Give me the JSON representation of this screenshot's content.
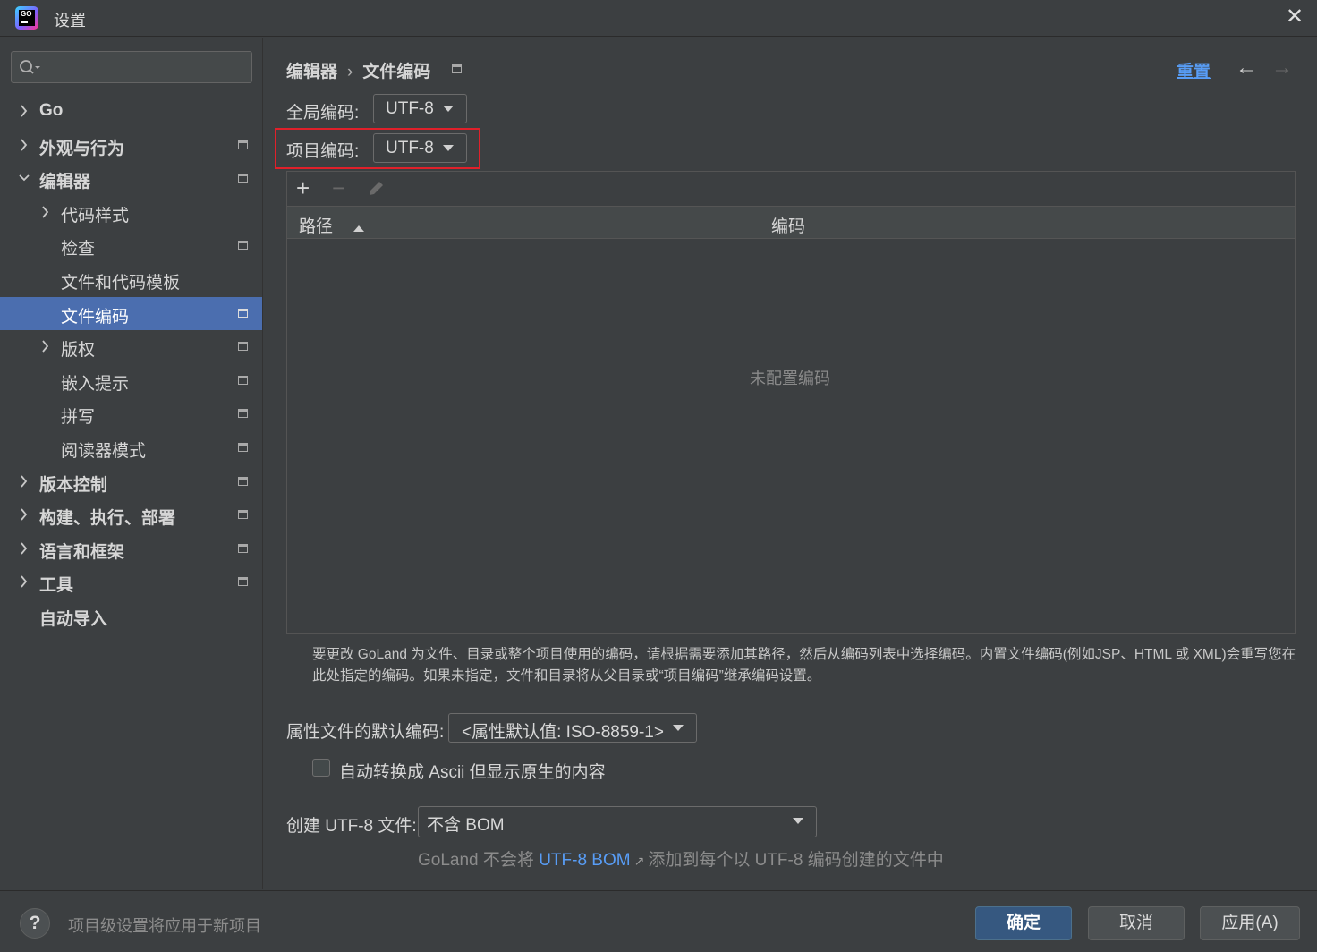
{
  "window": {
    "title": "设置",
    "logo_text": "GO"
  },
  "sidebar": {
    "search": {
      "value": "",
      "placeholder": ""
    },
    "items": [
      {
        "label": "Go",
        "level": 0,
        "expandable": true,
        "expanded": false,
        "bold": true,
        "project_icon": false
      },
      {
        "label": "外观与行为",
        "level": 0,
        "expandable": true,
        "expanded": false,
        "bold": true,
        "project_icon": true
      },
      {
        "label": "编辑器",
        "level": 0,
        "expandable": true,
        "expanded": true,
        "bold": true,
        "project_icon": true
      },
      {
        "label": "代码样式",
        "level": 1,
        "expandable": true,
        "expanded": false,
        "bold": false,
        "project_icon": false
      },
      {
        "label": "检查",
        "level": 1,
        "expandable": false,
        "bold": false,
        "project_icon": true
      },
      {
        "label": "文件和代码模板",
        "level": 1,
        "expandable": false,
        "bold": false,
        "project_icon": false
      },
      {
        "label": "文件编码",
        "level": 1,
        "expandable": false,
        "bold": false,
        "project_icon": true,
        "selected": true
      },
      {
        "label": "版权",
        "level": 1,
        "expandable": true,
        "expanded": false,
        "bold": false,
        "project_icon": true
      },
      {
        "label": "嵌入提示",
        "level": 1,
        "expandable": false,
        "bold": false,
        "project_icon": true
      },
      {
        "label": "拼写",
        "level": 1,
        "expandable": false,
        "bold": false,
        "project_icon": true
      },
      {
        "label": "阅读器模式",
        "level": 1,
        "expandable": false,
        "bold": false,
        "project_icon": true
      },
      {
        "label": "版本控制",
        "level": 0,
        "expandable": true,
        "expanded": false,
        "bold": true,
        "project_icon": true
      },
      {
        "label": "构建、执行、部署",
        "level": 0,
        "expandable": true,
        "expanded": false,
        "bold": true,
        "project_icon": true
      },
      {
        "label": "语言和框架",
        "level": 0,
        "expandable": true,
        "expanded": false,
        "bold": true,
        "project_icon": true
      },
      {
        "label": "工具",
        "level": 0,
        "expandable": true,
        "expanded": false,
        "bold": true,
        "project_icon": true
      },
      {
        "label": "自动导入",
        "level": 0,
        "expandable": false,
        "bold": true,
        "project_icon": false
      }
    ]
  },
  "header": {
    "breadcrumb": [
      "编辑器",
      "文件编码"
    ],
    "breadcrumb_sep": "›",
    "reset_label": "重置",
    "back_icon": "arrow-left-icon",
    "forward_icon": "arrow-right-icon"
  },
  "encoding": {
    "global_label": "全局编码:",
    "global_value": "UTF-8",
    "project_label": "项目编码:",
    "project_value": "UTF-8"
  },
  "table": {
    "toolbar": {
      "add": "+",
      "remove": "−",
      "edit_icon": "pencil-icon"
    },
    "columns": [
      "路径",
      "编码"
    ],
    "sort_column": "路径",
    "rows": [],
    "empty_text": "未配置编码"
  },
  "help_text": "要更改 GoLand 为文件、目录或整个项目使用的编码，请根据需要添加其路径，然后从编码列表中选择编码。内置文件编码(例如JSP、HTML 或 XML)会重写您在此处指定的编码。如果未指定，文件和目录将从父目录或“项目编码”继承编码设置。",
  "properties": {
    "label": "属性文件的默认编码:",
    "value": "<属性默认值: ISO-8859-1>",
    "ascii_checkbox_label": "自动转换成 Ascii 但显示原生的内容",
    "ascii_checked": false
  },
  "bom": {
    "label": "创建 UTF-8 文件:",
    "value": "不含 BOM",
    "note_prefix": "GoLand 不会将",
    "note_link": "UTF-8 BOM",
    "note_suffix": "添加到每个以 UTF-8 编码创建的文件中"
  },
  "footer": {
    "help_label": "?",
    "note": "项目级设置将应用于新项目",
    "ok_label": "确定",
    "cancel_label": "取消",
    "apply_label": "应用(A)"
  },
  "colors": {
    "background": "#3c3f41",
    "selection": "#4b6eaf",
    "link": "#589df6",
    "primary_button": "#365880",
    "highlight_border": "#e0202a"
  }
}
